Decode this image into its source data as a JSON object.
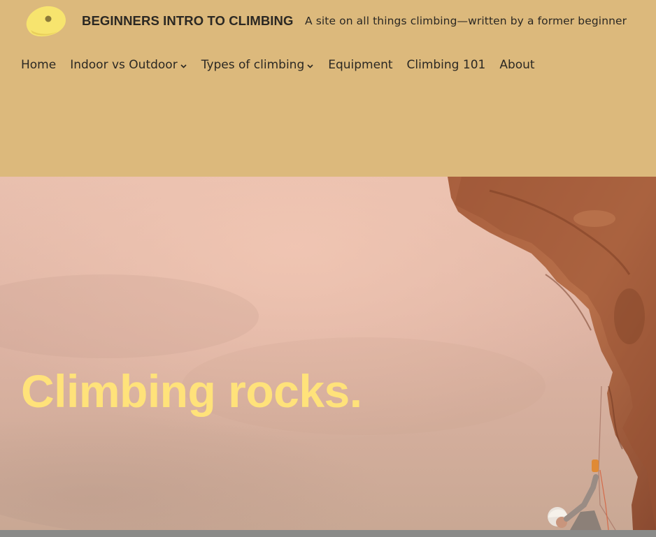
{
  "header": {
    "site_title": "BEGINNERS INTRO TO CLIMBING",
    "tagline": "A site on all things climbing—written by a former beginner",
    "logo_icon": "climbing-hold-icon",
    "background_color": "#dcb97c"
  },
  "nav": {
    "items": [
      {
        "label": "Home",
        "has_dropdown": false
      },
      {
        "label": "Indoor vs Outdoor",
        "has_dropdown": true
      },
      {
        "label": "Types of climbing",
        "has_dropdown": true
      },
      {
        "label": "Equipment",
        "has_dropdown": false
      },
      {
        "label": "Climbing 101",
        "has_dropdown": false
      },
      {
        "label": "About",
        "has_dropdown": false
      }
    ]
  },
  "hero": {
    "heading": "Climbing rocks.",
    "heading_color": "#ffe27a",
    "image_description_icon": "climber-on-cliff-image"
  }
}
